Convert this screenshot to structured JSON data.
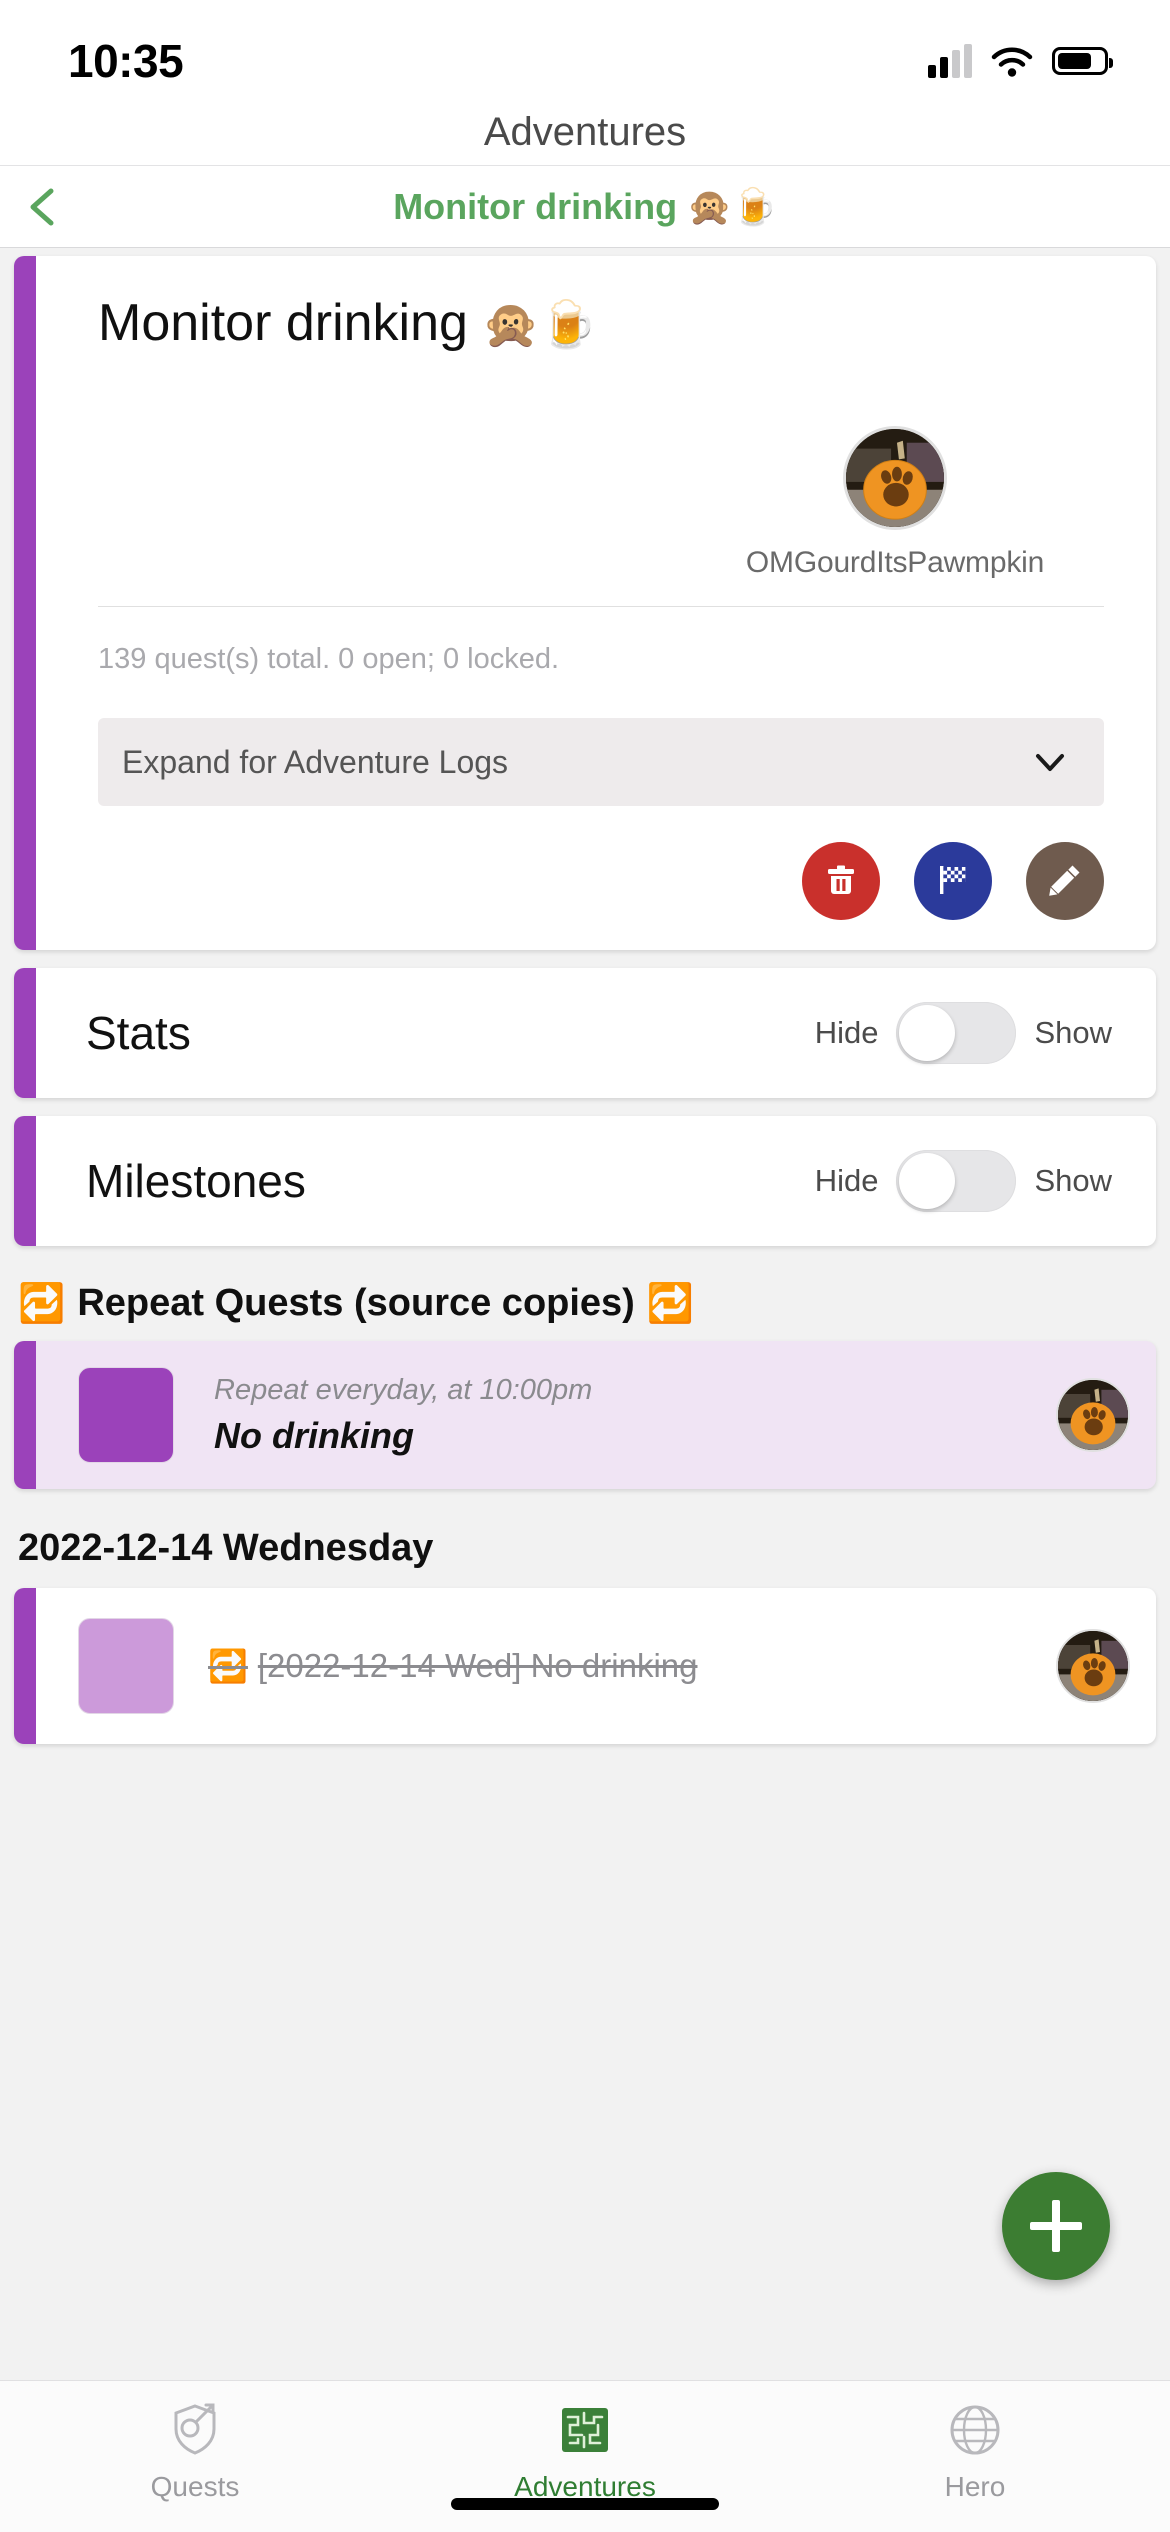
{
  "status_bar": {
    "time": "10:35",
    "signal_icon": "cellular-signal-icon",
    "wifi_icon": "wifi-icon",
    "battery_icon": "battery-icon"
  },
  "header": {
    "title": "Adventures"
  },
  "nav": {
    "back_icon": "chevron-left-icon",
    "breadcrumb_title": "Monitor drinking 🙊🍺",
    "accent_color": "#5aa55e"
  },
  "adventure": {
    "title": "Monitor drinking",
    "title_emoji": "🙊🍺",
    "owner": {
      "avatar_icon": "pumpkin-paw-avatar",
      "name": "OMGourdItsPawmpkin"
    },
    "quest_summary": "139 quest(s) total. 0 open; 0 locked.",
    "logs_expander": {
      "label": "Expand for Adventure Logs",
      "chevron_icon": "chevron-down-icon"
    },
    "actions": [
      {
        "name": "delete",
        "icon": "trash-icon",
        "color": "#c9302c"
      },
      {
        "name": "complete",
        "icon": "checkered-flag-icon",
        "color": "#2b3a9b"
      },
      {
        "name": "edit",
        "icon": "pencil-icon",
        "color": "#6f5b4e"
      }
    ],
    "accent_color": "#9b42ba"
  },
  "panels": [
    {
      "label": "Stats",
      "off_label": "Hide",
      "on_label": "Show",
      "state": "off"
    },
    {
      "label": "Milestones",
      "off_label": "Hide",
      "on_label": "Show",
      "state": "off"
    }
  ],
  "repeat_section": {
    "icon_left": "🔁",
    "title": "Repeat Quests (source copies)",
    "icon_right": "🔁",
    "quests": [
      {
        "swatch": "dark",
        "schedule": "Repeat everyday, at 10:00pm",
        "name": "No drinking",
        "avatar_icon": "pumpkin-paw-avatar"
      }
    ]
  },
  "date_group": {
    "date_label": "2022-12-14 Wednesday",
    "quests": [
      {
        "swatch": "light",
        "repeat_icon": "🔁",
        "text": "[2022-12-14 Wed] No drinking",
        "completed": true,
        "avatar_icon": "pumpkin-paw-avatar"
      }
    ]
  },
  "fab": {
    "icon": "plus-icon",
    "color": "#3c7d32"
  },
  "tab_bar": {
    "tabs": [
      {
        "label": "Quests",
        "icon": "shield-sword-icon",
        "active": false
      },
      {
        "label": "Adventures",
        "icon": "map-icon",
        "active": true
      },
      {
        "label": "Hero",
        "icon": "globe-icon",
        "active": false
      }
    ],
    "active_color": "#2f7d32",
    "inactive_color": "#9a9a9e"
  }
}
